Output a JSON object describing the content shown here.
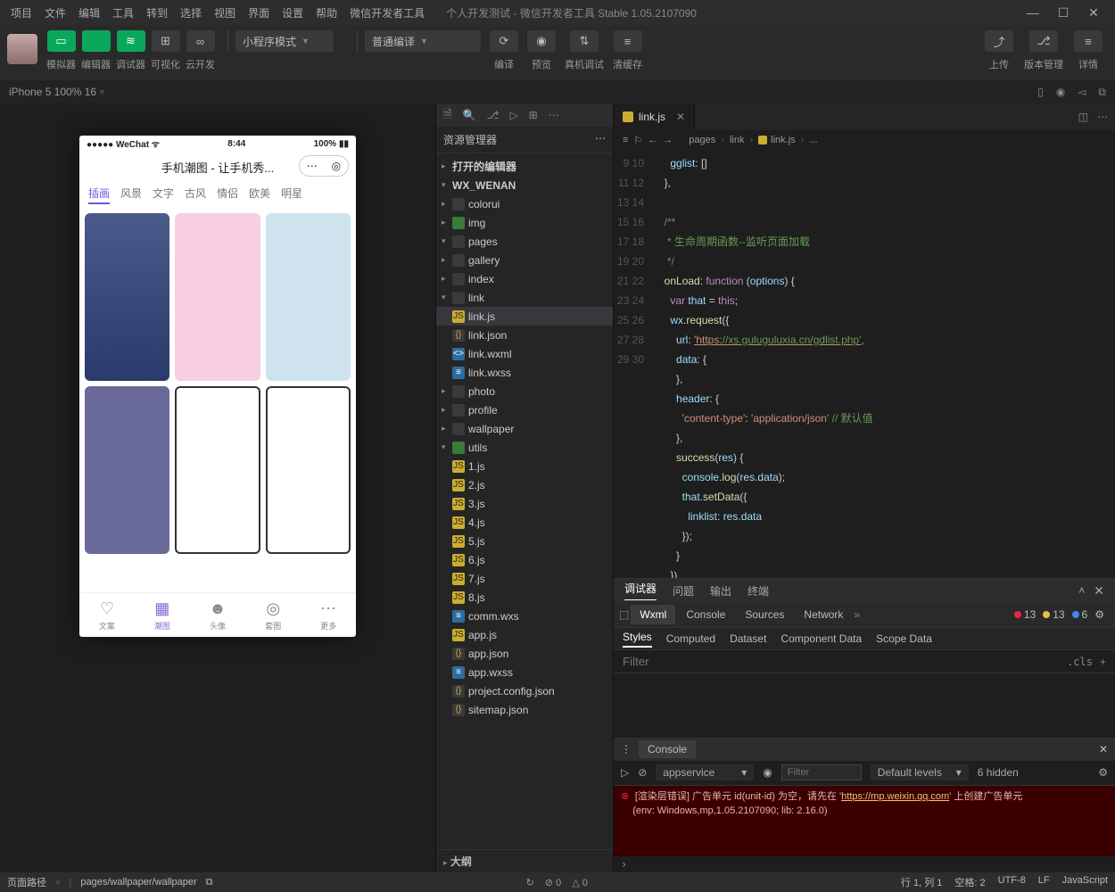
{
  "menus": [
    "项目",
    "文件",
    "编辑",
    "工具",
    "转到",
    "选择",
    "视图",
    "界面",
    "设置",
    "帮助",
    "微信开发者工具"
  ],
  "window_title": "个人开发测试 - 微信开发者工具 Stable 1.05.2107090",
  "toolbar": {
    "buttons": [
      {
        "label": "模拟器",
        "type": "green",
        "glyph": "▭"
      },
      {
        "label": "编辑器",
        "type": "green",
        "glyph": "</>"
      },
      {
        "label": "调试器",
        "type": "green",
        "glyph": "≋"
      },
      {
        "label": "可视化",
        "type": "dark",
        "glyph": "⊞"
      },
      {
        "label": "云开发",
        "type": "dark",
        "glyph": "∞"
      }
    ],
    "compile_mode": "小程序模式",
    "compile_type": "普通编译",
    "mid_buttons": [
      {
        "label": "编译",
        "glyph": "⟳"
      },
      {
        "label": "预览",
        "glyph": "◉"
      },
      {
        "label": "真机调试",
        "glyph": "⇅"
      },
      {
        "label": "清缓存",
        "glyph": "≡"
      }
    ],
    "right_buttons": [
      {
        "label": "上传",
        "glyph": "⤴"
      },
      {
        "label": "版本管理",
        "glyph": "⎇"
      },
      {
        "label": "详情",
        "glyph": "≡"
      }
    ]
  },
  "subbar": {
    "device": "iPhone 5 100% 16",
    "caret": "▾"
  },
  "phone": {
    "carrier": "●●●●● WeChat",
    "wifi": "⌵",
    "time": "8:44",
    "battery": "100%",
    "title": "手机潮图 - 让手机秀...",
    "tabs": [
      "插画",
      "风景",
      "文字",
      "古风",
      "情侣",
      "欧美",
      "明星"
    ],
    "active_tab": 0,
    "nav": [
      {
        "label": "文案",
        "glyph": "♡"
      },
      {
        "label": "潮图",
        "glyph": "▦"
      },
      {
        "label": "头像",
        "glyph": "☻"
      },
      {
        "label": "套图",
        "glyph": "◎"
      },
      {
        "label": "更多",
        "glyph": "⋯"
      }
    ],
    "nav_active": 1
  },
  "explorer": {
    "title": "资源管理器",
    "sections": {
      "open_editors": "打开的编辑器",
      "project": "WX_WENAN",
      "outline": "大纲"
    },
    "tree": [
      {
        "d": 1,
        "t": "folder",
        "n": "colorui"
      },
      {
        "d": 1,
        "t": "green",
        "n": "img"
      },
      {
        "d": 1,
        "t": "folder",
        "n": "pages",
        "open": true
      },
      {
        "d": 2,
        "t": "folder",
        "n": "gallery"
      },
      {
        "d": 2,
        "t": "folder",
        "n": "index"
      },
      {
        "d": 2,
        "t": "folder",
        "n": "link",
        "open": true
      },
      {
        "d": 3,
        "t": "js",
        "n": "link.js",
        "sel": true
      },
      {
        "d": 3,
        "t": "json",
        "n": "link.json"
      },
      {
        "d": 3,
        "t": "wxml",
        "n": "link.wxml"
      },
      {
        "d": 3,
        "t": "wxss",
        "n": "link.wxss"
      },
      {
        "d": 2,
        "t": "folder",
        "n": "photo"
      },
      {
        "d": 2,
        "t": "folder",
        "n": "profile"
      },
      {
        "d": 2,
        "t": "folder",
        "n": "wallpaper"
      },
      {
        "d": 1,
        "t": "green",
        "n": "utils",
        "open": true
      },
      {
        "d": 2,
        "t": "js",
        "n": "1.js"
      },
      {
        "d": 2,
        "t": "js",
        "n": "2.js"
      },
      {
        "d": 2,
        "t": "js",
        "n": "3.js"
      },
      {
        "d": 2,
        "t": "js",
        "n": "4.js"
      },
      {
        "d": 2,
        "t": "js",
        "n": "5.js"
      },
      {
        "d": 2,
        "t": "js",
        "n": "6.js"
      },
      {
        "d": 2,
        "t": "js",
        "n": "7.js"
      },
      {
        "d": 2,
        "t": "js",
        "n": "8.js"
      },
      {
        "d": 2,
        "t": "wxss",
        "n": "comm.wxs"
      },
      {
        "d": 1,
        "t": "js",
        "n": "app.js"
      },
      {
        "d": 1,
        "t": "json",
        "n": "app.json"
      },
      {
        "d": 1,
        "t": "wxss",
        "n": "app.wxss"
      },
      {
        "d": 1,
        "t": "json",
        "n": "project.config.json"
      },
      {
        "d": 1,
        "t": "json",
        "n": "sitemap.json"
      }
    ]
  },
  "editor": {
    "tab_name": "link.js",
    "breadcrumb": [
      "pages",
      "link",
      "link.js",
      "..."
    ],
    "line_start": 9,
    "code_lines": [
      "    gglist: []",
      "  },",
      "",
      "  /**",
      "   * 生命周期函数--监听页面加载",
      "   */",
      "  onLoad: function (options) {",
      "    var that = this;",
      "    wx.request({",
      "      url: 'https://xs.guluguluxia.cn/gdlist.php',",
      "      data: {",
      "      },",
      "      header: {",
      "        'content-type': 'application/json' // 默认值",
      "      },",
      "      success(res) {",
      "        console.log(res.data);",
      "        that.setData({",
      "          linklist: res.data",
      "        });",
      "      }",
      "    })"
    ]
  },
  "debugger": {
    "top_tabs": [
      "调试器",
      "问题",
      "输出",
      "终端"
    ],
    "devtools_tabs": [
      "Wxml",
      "Console",
      "Sources",
      "Network"
    ],
    "devtools_active": 0,
    "counts": {
      "errors": 13,
      "warnings": 13,
      "info": 6
    },
    "style_tabs": [
      "Styles",
      "Computed",
      "Dataset",
      "Component Data",
      "Scope Data"
    ],
    "filter_placeholder": "Filter",
    "cls": ".cls",
    "console_label": "Console",
    "console_context": "appservice",
    "levels": "Default levels",
    "hidden": "6 hidden",
    "error_line1": "[渲染层错误] 广告单元 id(unit-id) 为空，请先在 '",
    "error_url": "https://mp.weixin.qq.com",
    "error_line1_tail": "' 上创建广告单元",
    "error_line2": "(env: Windows,mp,1.05.2107090; lib: 2.16.0)"
  },
  "statusbar": {
    "route_label": "页面路径",
    "route": "pages/wallpaper/wallpaper",
    "errors": "⊘ 0",
    "warnings": "△ 0",
    "right": [
      "行 1, 列 1",
      "空格: 2",
      "UTF-8",
      "LF",
      "JavaScript"
    ]
  }
}
